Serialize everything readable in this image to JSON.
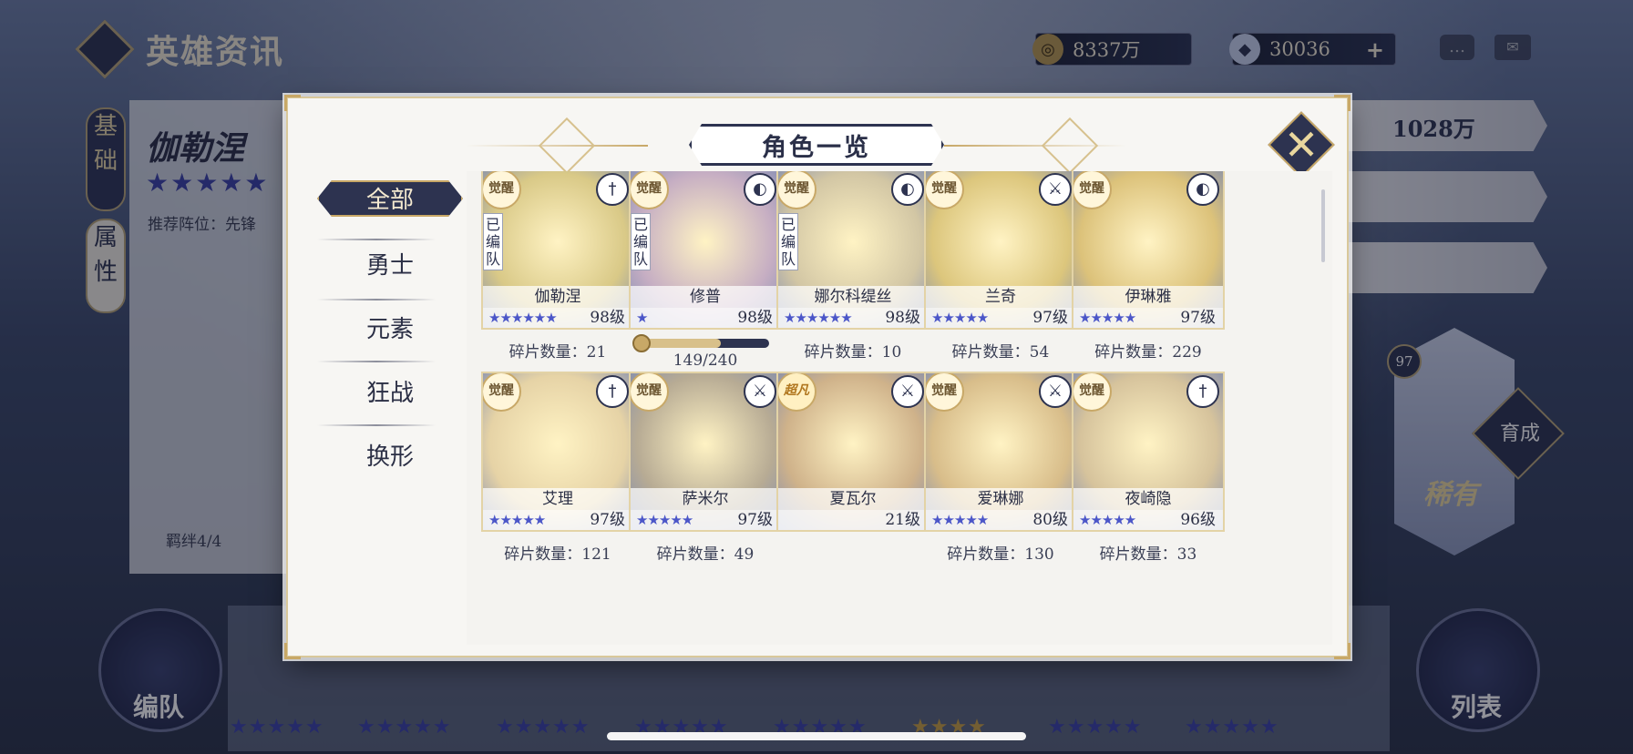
{
  "header": {
    "title": "英雄资讯"
  },
  "resources": [
    {
      "icon": "gold-coin-icon",
      "value": "8337万",
      "plus": ""
    },
    {
      "icon": "diamond-gem-icon",
      "value": "30036",
      "plus": "+"
    }
  ],
  "hero_panel": {
    "tabs": [
      "基础",
      "属性"
    ],
    "name": "伽勒涅",
    "stars": "★★★★★",
    "recommend": "推荐阵位：先锋",
    "bond": "羁绊4/4",
    "gold": "1028万",
    "level_badge": "97",
    "raise_button": "育成",
    "rarity": "稀有"
  },
  "bottom_nav": {
    "left_button": "编队",
    "right_button": "列表"
  },
  "modal": {
    "title": "角色一览",
    "filters": [
      {
        "label": "全部",
        "active": true
      },
      {
        "label": "勇士",
        "active": false
      },
      {
        "label": "元素",
        "active": false
      },
      {
        "label": "狂战",
        "active": false
      },
      {
        "label": "换形",
        "active": false
      }
    ],
    "heroes": [
      {
        "name": "伽勒涅",
        "level": "98级",
        "stars": "★★★★★★",
        "star_color": "blue",
        "awaken": "觉醒",
        "class_icon": "sword-class-icon",
        "class_glyph": "†",
        "in_team": "已编队",
        "shard": "碎片数量：21",
        "bg": "#d9c987"
      },
      {
        "name": "修普",
        "level": "98级",
        "stars": "★",
        "star_color": "blue",
        "awaken": "觉醒",
        "class_icon": "mask-class-icon",
        "class_glyph": "◐",
        "in_team": "已编队",
        "progress_text": "149/240",
        "progress": 0.62,
        "bg": "#c6aec3"
      },
      {
        "name": "娜尔科缇丝",
        "level": "98级",
        "stars": "★★★★★★",
        "star_color": "blue",
        "awaken": "觉醒",
        "class_icon": "mask-class-icon",
        "class_glyph": "◐",
        "in_team": "已编队",
        "shard": "碎片数量：10",
        "bg": "#d2c6a4"
      },
      {
        "name": "兰奇",
        "level": "97级",
        "stars": "★★★★★",
        "star_color": "blue",
        "awaken": "觉醒",
        "class_icon": "axe-class-icon",
        "class_glyph": "⚔",
        "in_team": "",
        "shard": "碎片数量：54",
        "bg": "#dcc67c"
      },
      {
        "name": "伊琳雅",
        "level": "97级",
        "stars": "★★★★★",
        "star_color": "blue",
        "awaken": "觉醒",
        "class_icon": "mask-class-icon",
        "class_glyph": "◐",
        "in_team": "",
        "shard": "碎片数量：229",
        "bg": "#dcc27a"
      },
      {
        "name": "艾理",
        "level": "97级",
        "stars": "★★★★★",
        "star_color": "blue",
        "awaken": "觉醒",
        "class_icon": "sword-class-icon",
        "class_glyph": "†",
        "in_team": "",
        "shard": "碎片数量：121",
        "bg": "#e6d3a6"
      },
      {
        "name": "萨米尔",
        "level": "97级",
        "stars": "★★★★★",
        "star_color": "blue",
        "awaken": "觉醒",
        "class_icon": "axe-class-icon",
        "class_glyph": "⚔",
        "in_team": "",
        "shard": "碎片数量：49",
        "bg": "#b7ab94"
      },
      {
        "name": "夏瓦尔",
        "level": "21级",
        "stars": "★★★★",
        "star_color": "gold",
        "awaken": "超凡",
        "awaken_super": true,
        "class_icon": "axe-class-icon",
        "class_glyph": "⚔",
        "in_team": "",
        "shard": "",
        "bg": "#cfb28a"
      },
      {
        "name": "爱琳娜",
        "level": "80级",
        "stars": "★★★★★",
        "star_color": "blue",
        "awaken": "觉醒",
        "class_icon": "axe-class-icon",
        "class_glyph": "⚔",
        "in_team": "",
        "shard": "碎片数量：130",
        "bg": "#d8bd8a"
      },
      {
        "name": "夜崎隐",
        "level": "96级",
        "stars": "★★★★★",
        "star_color": "blue",
        "awaken": "觉醒",
        "class_icon": "sword-class-icon",
        "class_glyph": "†",
        "in_team": "",
        "shard": "碎片数量：33",
        "bg": "#d6c39c"
      }
    ]
  }
}
